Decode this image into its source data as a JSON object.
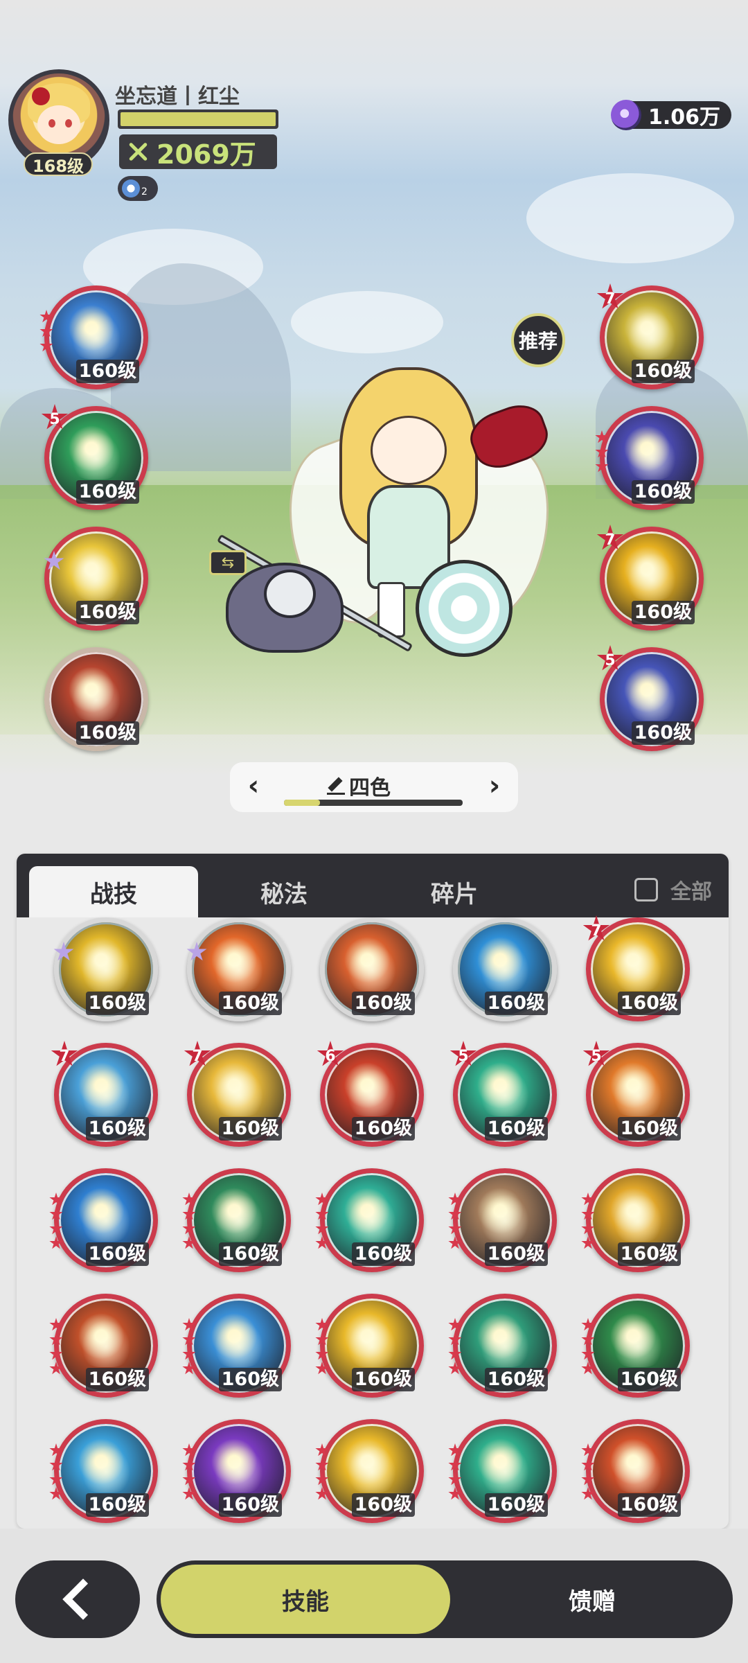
{
  "player": {
    "name": "坐忘道丨红尘",
    "level": "168级",
    "power": "2069万",
    "buff_count": "2"
  },
  "currency": {
    "value": "1.06万",
    "icon": "purple-gem-icon"
  },
  "recommend_label": "推荐",
  "equipped_left": [
    {
      "level": "160级",
      "rank": "",
      "stars": 3,
      "color": "#3b7fd0",
      "icon": "ice-dragon-skill-icon"
    },
    {
      "level": "160级",
      "rank": "5",
      "stars": 0,
      "color": "#2f9d5a",
      "icon": "green-wind-skill-icon"
    },
    {
      "level": "160级",
      "rank": "",
      "stars": 0,
      "color": "#e8c53a",
      "icon": "lightning-cat-skill-icon",
      "purple_star": true
    },
    {
      "level": "160级",
      "rank": "",
      "stars": 0,
      "color": "#b6452f",
      "icon": "fire-slash-skill-icon",
      "frame": "bronze"
    }
  ],
  "equipped_right": [
    {
      "level": "160级",
      "rank": "7",
      "stars": 0,
      "color": "#c9b33a",
      "icon": "golden-blade-skill-icon"
    },
    {
      "level": "160级",
      "rank": "",
      "stars": 3,
      "color": "#4a4ab0",
      "icon": "clock-skill-icon"
    },
    {
      "level": "160级",
      "rank": "7",
      "stars": 0,
      "color": "#e6b020",
      "icon": "golden-burst-skill-icon"
    },
    {
      "level": "160级",
      "rank": "5",
      "stars": 0,
      "color": "#4655b8",
      "icon": "starry-cage-skill-icon"
    }
  ],
  "preset": {
    "name": "四色",
    "progress": 0.2
  },
  "tabs": [
    {
      "label": "战技",
      "active": true
    },
    {
      "label": "秘法",
      "active": false
    },
    {
      "label": "碎片",
      "active": false
    }
  ],
  "show_all_label": "全部",
  "skills": [
    {
      "level": "160级",
      "color": "#e0b62a",
      "rank": "",
      "stars": 0,
      "purple_star": true,
      "frame": "silver",
      "icon": "golden-strike-icon"
    },
    {
      "level": "160级",
      "color": "#e2672a",
      "rank": "",
      "stars": 0,
      "purple_star": true,
      "frame": "silver",
      "icon": "fire-blast-icon"
    },
    {
      "level": "160级",
      "color": "#d8602f",
      "rank": "",
      "stars": 0,
      "frame": "silver",
      "icon": "flame-ring-icon"
    },
    {
      "level": "160级",
      "color": "#2f8fd6",
      "rank": "",
      "stars": 0,
      "frame": "silver",
      "icon": "water-vortex-icon"
    },
    {
      "level": "160级",
      "color": "#e9b72a",
      "rank": "7",
      "stars": 0,
      "icon": "golden-spark-icon"
    },
    {
      "level": "160级",
      "color": "#4aa0d8",
      "rank": "7",
      "stars": 0,
      "icon": "ice-crystal-icon"
    },
    {
      "level": "160级",
      "color": "#e7b83a",
      "rank": "7",
      "stars": 0,
      "icon": "golden-star-icon"
    },
    {
      "level": "160级",
      "color": "#c9402a",
      "rank": "6",
      "stars": 0,
      "icon": "red-flame-icon"
    },
    {
      "level": "160级",
      "color": "#2fae8b",
      "rank": "5",
      "stars": 0,
      "icon": "teal-leaf-icon"
    },
    {
      "level": "160级",
      "color": "#e0792a",
      "rank": "5",
      "stars": 0,
      "icon": "fire-fist-icon"
    },
    {
      "level": "160级",
      "color": "#2f7fd0",
      "rank": "",
      "stars": 4,
      "icon": "blue-wave-icon"
    },
    {
      "level": "160级",
      "color": "#2f8a5c",
      "rank": "",
      "stars": 4,
      "icon": "thorn-vine-icon"
    },
    {
      "level": "160级",
      "color": "#2fae96",
      "rank": "",
      "stars": 4,
      "icon": "teal-vortex-icon"
    },
    {
      "level": "160级",
      "color": "#a07a5a",
      "rank": "",
      "stars": 4,
      "icon": "rune-cards-icon"
    },
    {
      "level": "160级",
      "color": "#e0a62a",
      "rank": "",
      "stars": 4,
      "icon": "golden-beam-icon"
    },
    {
      "level": "160级",
      "color": "#c0502a",
      "rank": "",
      "stars": 4,
      "icon": "fire-swirl-icon"
    },
    {
      "level": "160级",
      "color": "#3a8fd6",
      "rank": "",
      "stars": 4,
      "icon": "blue-shard-icon"
    },
    {
      "level": "160级",
      "color": "#e8b82a",
      "rank": "",
      "stars": 4,
      "icon": "sun-triangle-icon"
    },
    {
      "level": "160级",
      "color": "#2f9d7a",
      "rank": "",
      "stars": 4,
      "icon": "green-orb-icon"
    },
    {
      "level": "160级",
      "color": "#2f8a4a",
      "rank": "",
      "stars": 4,
      "icon": "green-cross-icon"
    },
    {
      "level": "160级",
      "color": "#3a9fd8",
      "rank": "",
      "stars": 4,
      "icon": "water-splash-icon"
    },
    {
      "level": "160级",
      "color": "#7a3ac0",
      "rank": "",
      "stars": 4,
      "icon": "purple-storm-icon"
    },
    {
      "level": "160级",
      "color": "#e8b82a",
      "rank": "",
      "stars": 4,
      "icon": "golden-pyramid-icon"
    },
    {
      "level": "160级",
      "color": "#2fae8b",
      "rank": "",
      "stars": 4,
      "icon": "teal-swirl-icon"
    },
    {
      "level": "160级",
      "color": "#d0502a",
      "rank": "",
      "stars": 4,
      "icon": "lava-burst-icon"
    }
  ],
  "bottom_nav": {
    "skill_label": "技能",
    "gift_label": "馈赠"
  }
}
